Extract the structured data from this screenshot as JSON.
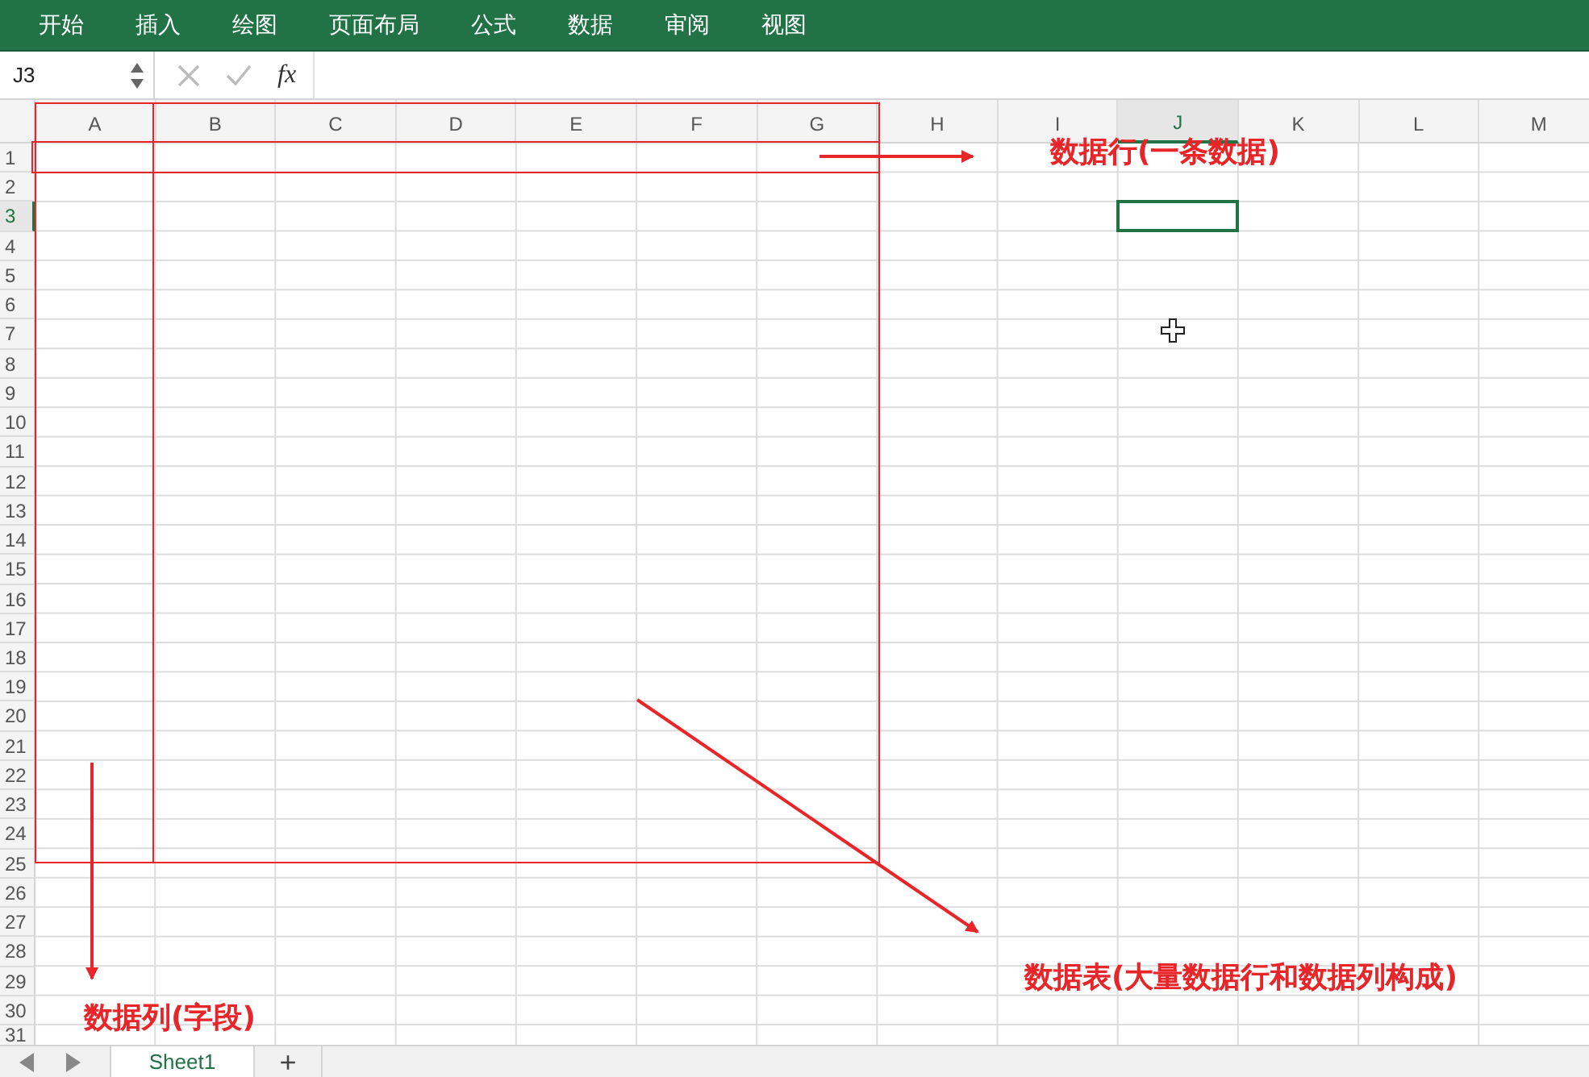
{
  "ribbon": {
    "tabs": [
      {
        "label": "开始"
      },
      {
        "label": "插入"
      },
      {
        "label": "绘图"
      },
      {
        "label": "页面布局"
      },
      {
        "label": "公式"
      },
      {
        "label": "数据"
      },
      {
        "label": "审阅"
      },
      {
        "label": "视图"
      }
    ]
  },
  "formula_bar": {
    "name_box": "J3",
    "function_label": "fx"
  },
  "sheet": {
    "columns": [
      {
        "label": "A",
        "selected": false
      },
      {
        "label": "B",
        "selected": false
      },
      {
        "label": "C",
        "selected": false
      },
      {
        "label": "D",
        "selected": false
      },
      {
        "label": "E",
        "selected": false
      },
      {
        "label": "F",
        "selected": false
      },
      {
        "label": "G",
        "selected": false
      },
      {
        "label": "H",
        "selected": false
      },
      {
        "label": "I",
        "selected": false
      },
      {
        "label": "J",
        "selected": true
      },
      {
        "label": "K",
        "selected": false
      },
      {
        "label": "L",
        "selected": false
      },
      {
        "label": "M",
        "selected": false
      }
    ],
    "rows": [
      {
        "label": "1",
        "selected": false
      },
      {
        "label": "2",
        "selected": false
      },
      {
        "label": "3",
        "selected": true
      },
      {
        "label": "4",
        "selected": false
      },
      {
        "label": "5",
        "selected": false
      },
      {
        "label": "6",
        "selected": false
      },
      {
        "label": "7",
        "selected": false
      },
      {
        "label": "8",
        "selected": false
      },
      {
        "label": "9",
        "selected": false
      },
      {
        "label": "10",
        "selected": false
      },
      {
        "label": "11",
        "selected": false
      },
      {
        "label": "12",
        "selected": false
      },
      {
        "label": "13",
        "selected": false
      },
      {
        "label": "14",
        "selected": false
      },
      {
        "label": "15",
        "selected": false
      },
      {
        "label": "16",
        "selected": false
      },
      {
        "label": "17",
        "selected": false
      },
      {
        "label": "18",
        "selected": false
      },
      {
        "label": "19",
        "selected": false
      },
      {
        "label": "20",
        "selected": false
      },
      {
        "label": "21",
        "selected": false
      },
      {
        "label": "22",
        "selected": false
      },
      {
        "label": "23",
        "selected": false
      },
      {
        "label": "24",
        "selected": false
      },
      {
        "label": "25",
        "selected": false
      },
      {
        "label": "26",
        "selected": false
      },
      {
        "label": "27",
        "selected": false
      },
      {
        "label": "28",
        "selected": false
      },
      {
        "label": "29",
        "selected": false
      },
      {
        "label": "30",
        "selected": false
      },
      {
        "label": "31",
        "selected": false
      }
    ]
  },
  "annotations": [
    {
      "text": "数据行(一条数据)"
    },
    {
      "text": "数据表(大量数据行和数据列构成)"
    },
    {
      "text": "数据列(字段)"
    }
  ],
  "sheet_tabs": {
    "tabs": [
      {
        "label": "Sheet1",
        "selected": true
      }
    ],
    "add_label": "+"
  }
}
